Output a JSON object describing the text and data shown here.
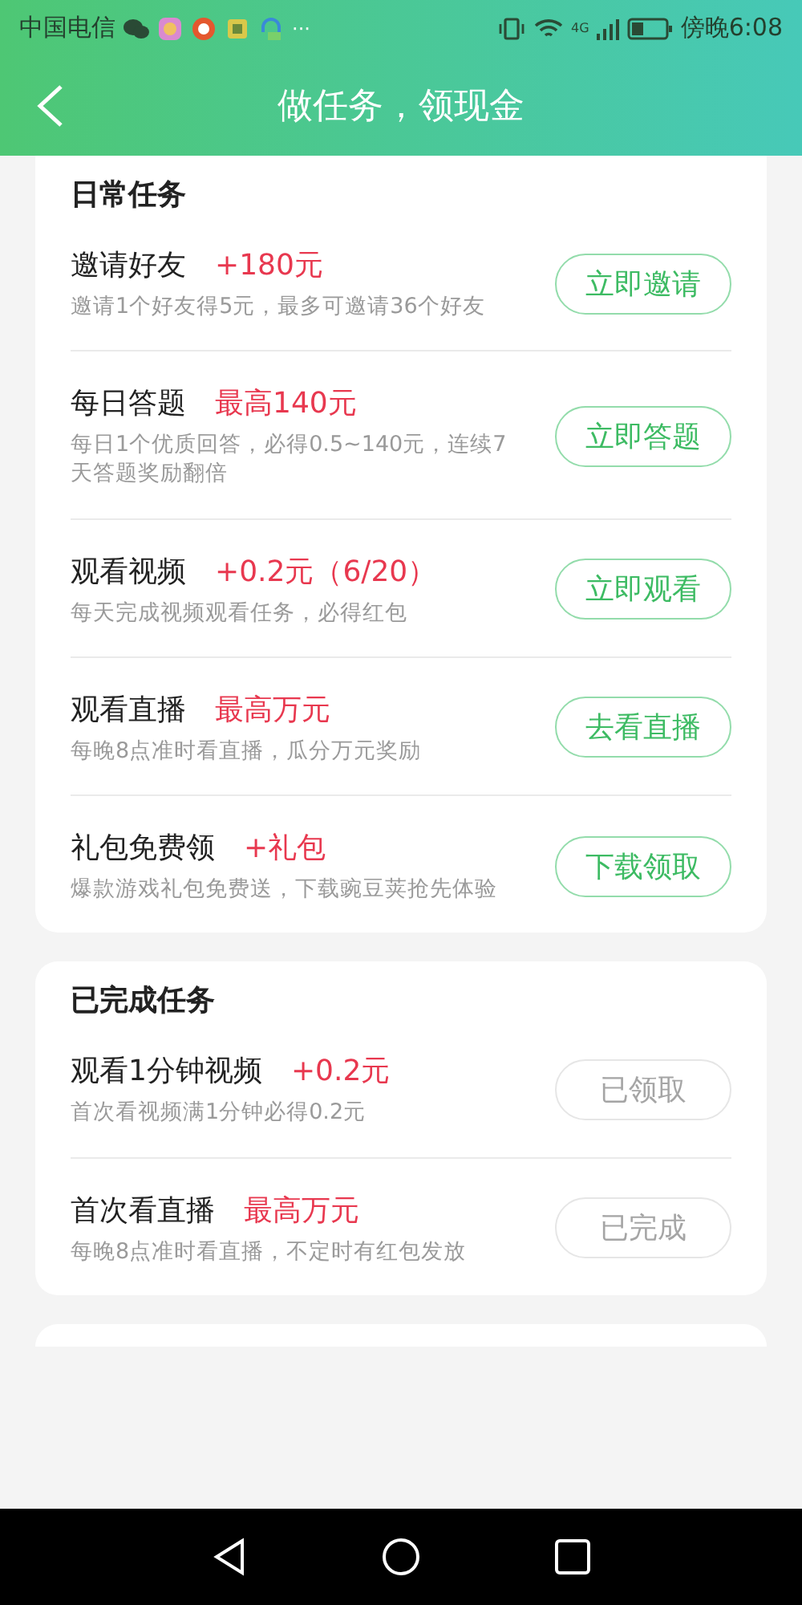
{
  "status_bar": {
    "carrier": "中国电信",
    "time": "傍晚6:08",
    "more": "···",
    "network": "4G"
  },
  "header": {
    "title": "做任务，领现金"
  },
  "sections": [
    {
      "title": "日常任务",
      "tasks": [
        {
          "title": "邀请好友",
          "reward": "+180元",
          "desc": "邀请1个好友得5元，最多可邀请36个好友",
          "button": {
            "label": "立即邀请",
            "disabled": false
          }
        },
        {
          "title": "每日答题",
          "reward": "最高140元",
          "desc": "每日1个优质回答，必得0.5~140元，连续7天答题奖励翻倍",
          "button": {
            "label": "立即答题",
            "disabled": false
          }
        },
        {
          "title": "观看视频",
          "reward": "+0.2元（6/20）",
          "desc": "每天完成视频观看任务，必得红包",
          "button": {
            "label": "立即观看",
            "disabled": false
          }
        },
        {
          "title": "观看直播",
          "reward": "最高万元",
          "desc": "每晚8点准时看直播，瓜分万元奖励",
          "button": {
            "label": "去看直播",
            "disabled": false
          }
        },
        {
          "title": "礼包免费领",
          "reward": "+礼包",
          "desc": "爆款游戏礼包免费送，下载豌豆荚抢先体验",
          "button": {
            "label": "下载领取",
            "disabled": false
          }
        }
      ]
    },
    {
      "title": "已完成任务",
      "tasks": [
        {
          "title": "观看1分钟视频",
          "reward": "+0.2元",
          "desc": "首次看视频满1分钟必得0.2元",
          "button": {
            "label": "已领取",
            "disabled": true
          }
        },
        {
          "title": "首次看直播",
          "reward": "最高万元",
          "desc": "每晚8点准时看直播，不定时有红包发放",
          "button": {
            "label": "已完成",
            "disabled": true
          }
        }
      ]
    }
  ]
}
